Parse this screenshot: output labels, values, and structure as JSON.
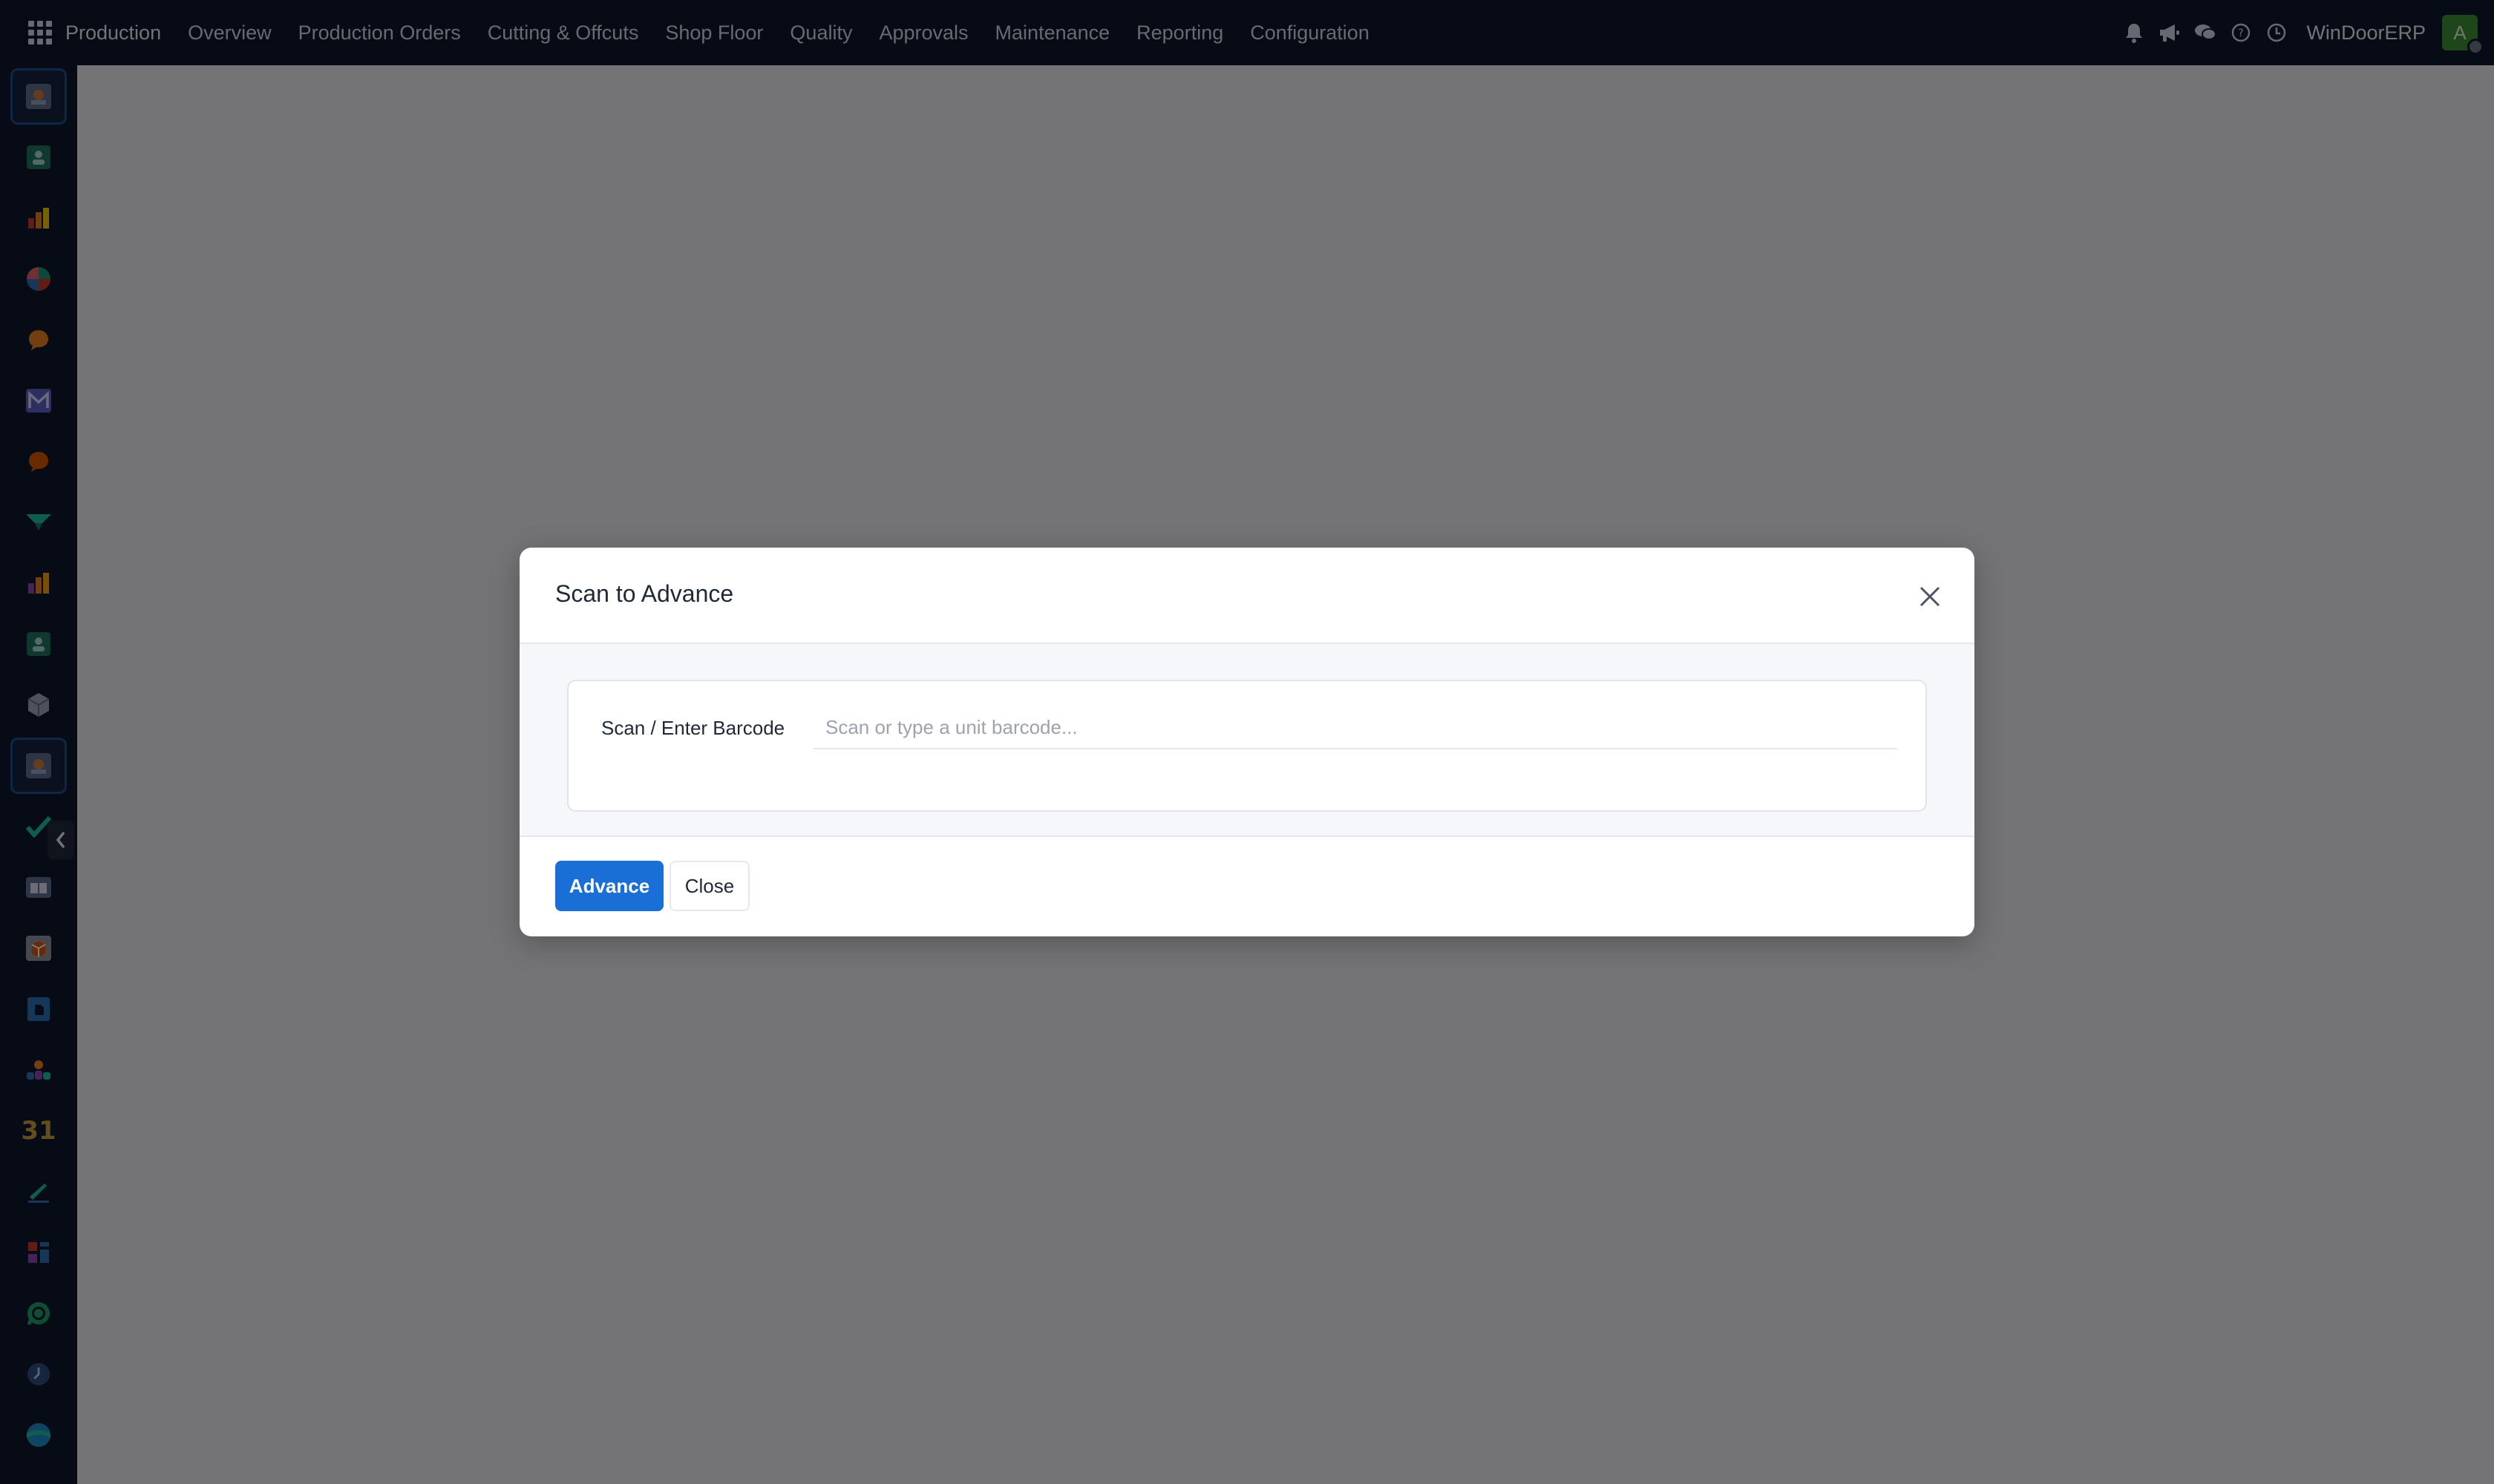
{
  "navbar": {
    "brand": "Production",
    "menu": [
      "Overview",
      "Production Orders",
      "Cutting & Offcuts",
      "Shop Floor",
      "Quality",
      "Approvals",
      "Maintenance",
      "Reporting",
      "Configuration"
    ],
    "company": "WinDoorERP",
    "avatar_initial": "A",
    "icons": [
      "bell-icon",
      "megaphone-icon",
      "chat-icon",
      "help-icon",
      "clock-icon"
    ]
  },
  "sidebar": {
    "items": [
      "production-app-icon",
      "contacts-app-icon",
      "reporting-app-icon",
      "crm-app-icon",
      "discuss-app-icon",
      "email-marketing-app-icon",
      "livechat-app-icon",
      "project-app-icon",
      "bar-chart-app-icon",
      "employees-app-icon",
      "inventory-app-icon",
      "production-app-icon",
      "quality-app-icon",
      "knowledge-app-icon",
      "purchase-app-icon",
      "documents-app-icon",
      "team-app-icon",
      "calendar-app-icon",
      "sign-app-icon",
      "dashboard-app-icon",
      "whatsapp-app-icon",
      "timesheet-app-icon",
      "website-app-icon"
    ],
    "calendar_day": "31"
  },
  "modal": {
    "title": "Scan to Advance",
    "field_label": "Scan / Enter Barcode",
    "input_value": "",
    "input_placeholder": "Scan or type a unit barcode...",
    "primary_button": "Advance",
    "secondary_button": "Close"
  },
  "colors": {
    "navbar_bg": "#0f172a",
    "primary": "#1a6fd6",
    "avatar": "#3c8d35"
  }
}
